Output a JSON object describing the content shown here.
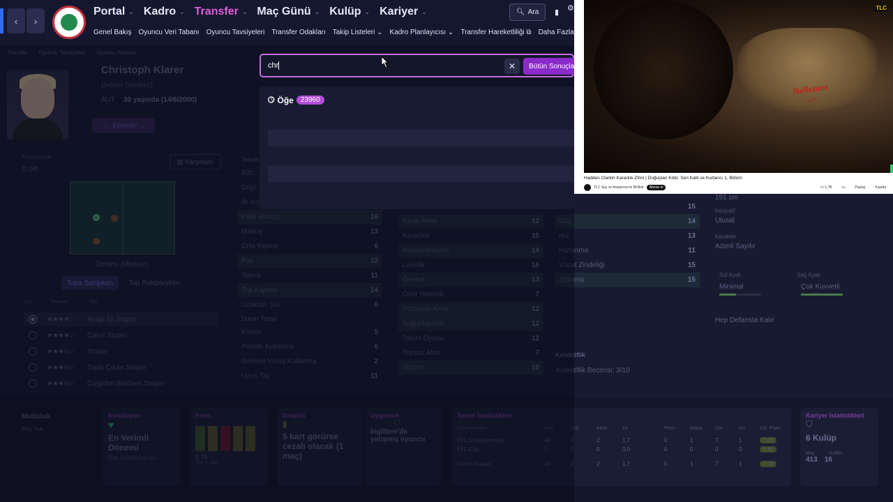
{
  "header": {
    "main_nav": [
      {
        "label": "Portal",
        "active": false
      },
      {
        "label": "Kadro",
        "active": false
      },
      {
        "label": "Transfer",
        "active": true
      },
      {
        "label": "Maç Günü",
        "active": false
      },
      {
        "label": "Kulüp",
        "active": false
      },
      {
        "label": "Kariyer",
        "active": false
      }
    ],
    "sub_nav": [
      "Genel Bakış",
      "Oyuncu Veri Tabanı",
      "Oyuncu Tavsiyeleri",
      "Transfer Odakları",
      "Takip Listeleri",
      "Kadro Planlayıcısı",
      "Transfer Hareketliliği",
      "Daha Fazla"
    ],
    "search_label": "Ara"
  },
  "breadcrumb": [
    "Transfer",
    "Oyuncu Tavsiyeleri",
    "Oyuncu Raporu"
  ],
  "player": {
    "name": "Christoph Klarer",
    "position": "Defans (Merkez)",
    "nationality": "AUT",
    "age": "30 yaşında (14/6/2000)",
    "actions_label": "Eylemler",
    "compare_label": "Karşılaştır",
    "positions_label": "Pozisyonlar",
    "positions_value": "D (M)",
    "pitch_position": "Defans (Merkez)",
    "tab_with_ball": "Topa Sahipken",
    "tab_without_ball": "Top Rakipteyken"
  },
  "roles": {
    "headers": [
      "Seç",
      "Yetenek",
      "Rol"
    ],
    "items": [
      {
        "stars": "★★★★☆",
        "label": "Ayağı İyi Stoper",
        "selected": true
      },
      {
        "stars": "★★★★☆",
        "label": "Çakılı Stoper",
        "selected": false
      },
      {
        "stars": "★★★½☆",
        "label": "Stoper",
        "selected": false
      },
      {
        "stars": "★★★½☆",
        "label": "Topla Çıkan Stoper",
        "selected": false
      },
      {
        "stars": "★★★½☆",
        "label": "Çizgiden Bindiren Stoper",
        "selected": false
      }
    ]
  },
  "attributes": {
    "col1_title": "Teknik",
    "col1": [
      {
        "name": "Bitir...",
        "value": ""
      },
      {
        "name": "Dripl...",
        "value": ""
      },
      {
        "name": "İlk Kontrol",
        "value": ""
      },
      {
        "name": "Kafa Vuruşu",
        "value": "16"
      },
      {
        "name": "Markaj",
        "value": "13"
      },
      {
        "name": "Orta Yapma",
        "value": "6"
      },
      {
        "name": "Pas",
        "value": "12"
      },
      {
        "name": "Teknik",
        "value": "11"
      },
      {
        "name": "Top Kapma",
        "value": "14"
      },
      {
        "name": "Uzaktan Şut",
        "value": "6"
      }
    ],
    "set_pieces_title": "Duran Toplar",
    "set_pieces": [
      {
        "name": "Korner",
        "value": "5"
      },
      {
        "name": "Penaltı Kullanma",
        "value": "6"
      },
      {
        "name": "Serbest Vuruş Kullanma",
        "value": "2"
      },
      {
        "name": "Uzun Taç",
        "value": "11"
      }
    ],
    "col2": [
      {
        "name": "Karar Alma",
        "value": "12"
      },
      {
        "name": "Kararlılık",
        "value": "15"
      },
      {
        "name": "Konsantrasyon",
        "value": "14"
      },
      {
        "name": "Liderlik",
        "value": "16"
      },
      {
        "name": "Önsezi",
        "value": "13"
      },
      {
        "name": "Özel Yetenek",
        "value": "7"
      },
      {
        "name": "Pozisyon Alma",
        "value": "12"
      },
      {
        "name": "Soğukkanlılık",
        "value": "12"
      },
      {
        "name": "Takım Oyunu",
        "value": "12"
      },
      {
        "name": "Topsuz Alan",
        "value": "7"
      },
      {
        "name": "Vizyon",
        "value": "10"
      }
    ],
    "col3": [
      {
        "name": "Güç",
        "value": "14"
      },
      {
        "name": "Hız",
        "value": "13"
      },
      {
        "name": "Hızlanma",
        "value": "11"
      },
      {
        "name": "Vücut Zindeliği",
        "value": "15"
      },
      {
        "name": "Zıplama",
        "value": "15"
      }
    ],
    "col3_top_value": "15",
    "teamwork_title": "Kolektiflik",
    "teamwork_value": "Kolektiflik Becerisi: 3/10"
  },
  "info": {
    "height": "191 cm",
    "personality_label": "İnisiyatif",
    "personality_value": "Ulusal",
    "traits_label": "Karakter",
    "traits_value": "Azimli Sayılır",
    "left_foot_label": "Sol Ayak",
    "left_foot_value": "Minimal",
    "right_foot_label": "Sağ Ayak",
    "right_foot_value": "Çok Kuvvetli",
    "preference": "Hep Defansta Kalır"
  },
  "bottom": {
    "happiness_title": "Mutluluk",
    "happiness_value": "Bilgi Yok",
    "condition_title": "Kondisyon",
    "condition_value": "En Verimli Dönemi",
    "condition_sub": "Maç kondisyonu ek...",
    "form_title": "Form",
    "form_value": "6,78",
    "form_sub": "Son 5 Maç",
    "discipline_title": "Disiplin",
    "discipline_value": "5 kart görürse cezalı olacak (1 maç)",
    "nation_title": "Uygunluk",
    "nation_value": "İngiltere'de yetişmiş oyuncu",
    "season_title": "Sezon İstatistikleri",
    "season_headers": [
      "Organizasyon",
      "Maç",
      "Gol",
      "Asist",
      "xA",
      "Pens",
      "Maça",
      "Sar",
      "Kır",
      "Ort. Puan"
    ],
    "season_rows": [
      {
        "org": "EFL Championship",
        "cells": [
          "44",
          "2",
          "2",
          "1,7",
          "0",
          "1",
          "7",
          "1"
        ],
        "rating": "7,03"
      },
      {
        "org": "EFL Cup",
        "cells": [
          "1",
          "0",
          "0",
          "0,0",
          "0",
          "0",
          "0",
          "0"
        ],
        "rating": "6,40"
      },
      {
        "org": "Genel (Kulüp)",
        "cells": [
          "46",
          "2",
          "2",
          "1,7",
          "0",
          "1",
          "7",
          "1"
        ],
        "rating": "7,00"
      }
    ],
    "career_title": "Kariyer İstatistikleri",
    "career_value": "6 Kulüp",
    "career_apps_label": "Maç",
    "career_apps": "413",
    "career_goals_label": "Goller",
    "career_goals": "16"
  },
  "search": {
    "query": "chr",
    "all_results_label": "Bütün Sonuçlar",
    "result_label": "Öğe",
    "result_count": "23960"
  },
  "video": {
    "title": "Hadden Clarkin Karanlık Zihni | Doğuştan Kötü: Seri Katil ve Kurtarıcı 1. Bölüm",
    "channel": "TLC Suç ve Araştırma ile Birlikte",
    "subscribe": "Abone ol",
    "likes": "1,7B",
    "share": "Paylaş",
    "save": "Kaydet",
    "logo": "TLC",
    "overlay_red": "Bellenmt",
    "overlay_red2": "aaA"
  }
}
